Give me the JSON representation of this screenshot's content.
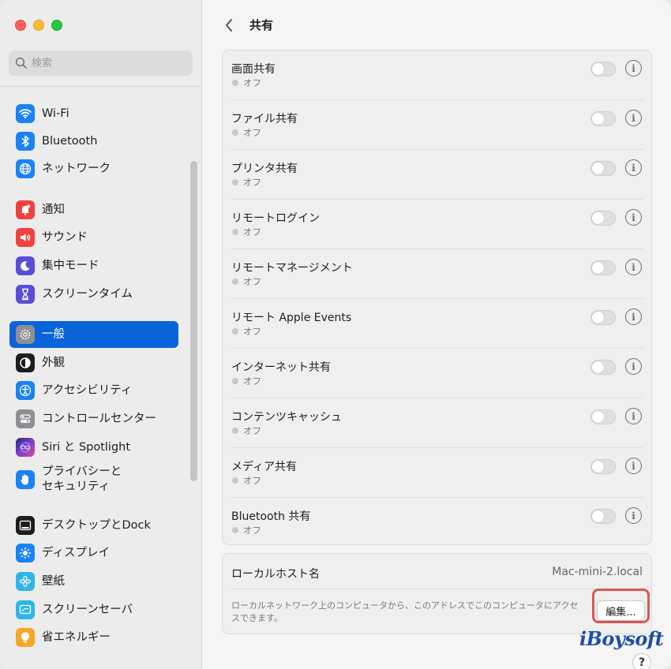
{
  "search": {
    "placeholder": "検索"
  },
  "sidebar": {
    "items": [
      {
        "label": "Wi-Fi",
        "icon": "wifi-icon",
        "color": "#1a82f5"
      },
      {
        "label": "Bluetooth",
        "icon": "bluetooth-icon",
        "color": "#1a82f5"
      },
      {
        "label": "ネットワーク",
        "icon": "globe-icon",
        "color": "#1a82f5"
      },
      {
        "label": "通知",
        "icon": "notification-bell-icon",
        "color": "#f0413f"
      },
      {
        "label": "サウンド",
        "icon": "speaker-icon",
        "color": "#f0413f"
      },
      {
        "label": "集中モード",
        "icon": "moon-icon",
        "color": "#5b4ed6"
      },
      {
        "label": "スクリーンタイム",
        "icon": "hourglass-icon",
        "color": "#5b4ed6"
      },
      {
        "label": "一般",
        "icon": "gear-icon",
        "color": "#8e8e93",
        "selected": true
      },
      {
        "label": "外観",
        "icon": "appearance-icon",
        "color": "#1d1d1f"
      },
      {
        "label": "アクセシビリティ",
        "icon": "accessibility-icon",
        "color": "#1a82f5"
      },
      {
        "label": "コントロールセンター",
        "icon": "control-center-icon",
        "color": "#8e8e93"
      },
      {
        "label": "Siri と Spotlight",
        "icon": "siri-icon",
        "color": "#7a3ed6"
      },
      {
        "label": "プライバシーと\nセキュリティ",
        "icon": "hand-icon",
        "color": "#1a82f5"
      },
      {
        "label": "デスクトップとDock",
        "icon": "dock-icon",
        "color": "#1d1d1f"
      },
      {
        "label": "ディスプレイ",
        "icon": "sun-icon",
        "color": "#1a82f5"
      },
      {
        "label": "壁紙",
        "icon": "wallpaper-flower-icon",
        "color": "#2fb5ea"
      },
      {
        "label": "スクリーンセーバ",
        "icon": "screensaver-icon",
        "color": "#2fb5ea"
      },
      {
        "label": "省エネルギー",
        "icon": "lightbulb-icon",
        "color": "#f5a623"
      }
    ]
  },
  "header": {
    "title": "共有"
  },
  "sharing": {
    "items": [
      {
        "label": "画面共有",
        "status": "オフ"
      },
      {
        "label": "ファイル共有",
        "status": "オフ"
      },
      {
        "label": "プリンタ共有",
        "status": "オフ"
      },
      {
        "label": "リモートログイン",
        "status": "オフ"
      },
      {
        "label": "リモートマネージメント",
        "status": "オフ"
      },
      {
        "label": "リモート Apple Events",
        "status": "オフ"
      },
      {
        "label": "インターネット共有",
        "status": "オフ"
      },
      {
        "label": "コンテンツキャッシュ",
        "status": "オフ"
      },
      {
        "label": "メディア共有",
        "status": "オフ"
      },
      {
        "label": "Bluetooth 共有",
        "status": "オフ"
      }
    ],
    "info_symbol": "i"
  },
  "hostname": {
    "label": "ローカルホスト名",
    "value": "Mac-mini-2.local",
    "description": "ローカルネットワーク上のコンピュータから、このアドレスでこのコンピュータにアクセスできます。",
    "edit_label": "編集..."
  },
  "help": {
    "symbol": "?"
  },
  "watermark": {
    "text": "iBoysoft"
  },
  "colors": {
    "accent": "#0a63d8",
    "highlight": "#e05555"
  }
}
